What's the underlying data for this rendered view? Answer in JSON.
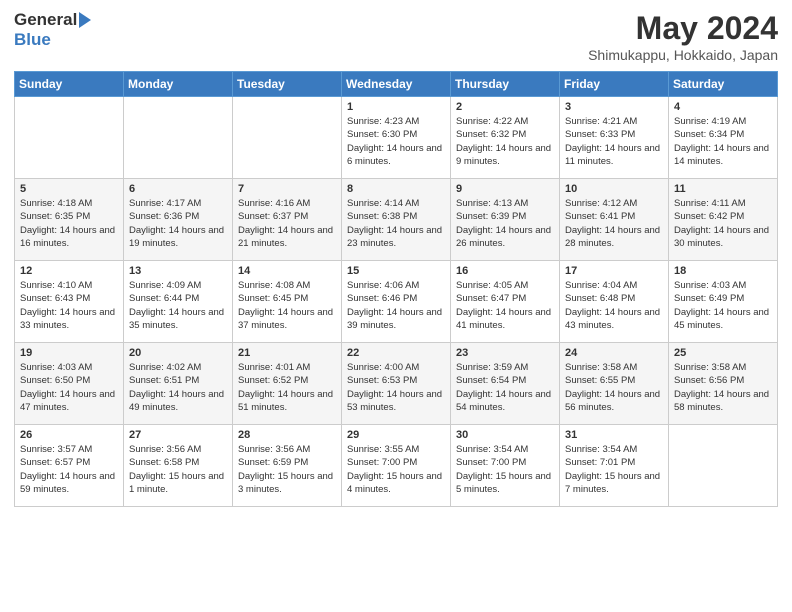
{
  "logo": {
    "general": "General",
    "blue": "Blue"
  },
  "title": {
    "month": "May 2024",
    "location": "Shimukappu, Hokkaido, Japan"
  },
  "calendar": {
    "headers": [
      "Sunday",
      "Monday",
      "Tuesday",
      "Wednesday",
      "Thursday",
      "Friday",
      "Saturday"
    ],
    "weeks": [
      [
        {
          "day": "",
          "sunrise": "",
          "sunset": "",
          "daylight": ""
        },
        {
          "day": "",
          "sunrise": "",
          "sunset": "",
          "daylight": ""
        },
        {
          "day": "",
          "sunrise": "",
          "sunset": "",
          "daylight": ""
        },
        {
          "day": "1",
          "sunrise": "Sunrise: 4:23 AM",
          "sunset": "Sunset: 6:30 PM",
          "daylight": "Daylight: 14 hours and 6 minutes."
        },
        {
          "day": "2",
          "sunrise": "Sunrise: 4:22 AM",
          "sunset": "Sunset: 6:32 PM",
          "daylight": "Daylight: 14 hours and 9 minutes."
        },
        {
          "day": "3",
          "sunrise": "Sunrise: 4:21 AM",
          "sunset": "Sunset: 6:33 PM",
          "daylight": "Daylight: 14 hours and 11 minutes."
        },
        {
          "day": "4",
          "sunrise": "Sunrise: 4:19 AM",
          "sunset": "Sunset: 6:34 PM",
          "daylight": "Daylight: 14 hours and 14 minutes."
        }
      ],
      [
        {
          "day": "5",
          "sunrise": "Sunrise: 4:18 AM",
          "sunset": "Sunset: 6:35 PM",
          "daylight": "Daylight: 14 hours and 16 minutes."
        },
        {
          "day": "6",
          "sunrise": "Sunrise: 4:17 AM",
          "sunset": "Sunset: 6:36 PM",
          "daylight": "Daylight: 14 hours and 19 minutes."
        },
        {
          "day": "7",
          "sunrise": "Sunrise: 4:16 AM",
          "sunset": "Sunset: 6:37 PM",
          "daylight": "Daylight: 14 hours and 21 minutes."
        },
        {
          "day": "8",
          "sunrise": "Sunrise: 4:14 AM",
          "sunset": "Sunset: 6:38 PM",
          "daylight": "Daylight: 14 hours and 23 minutes."
        },
        {
          "day": "9",
          "sunrise": "Sunrise: 4:13 AM",
          "sunset": "Sunset: 6:39 PM",
          "daylight": "Daylight: 14 hours and 26 minutes."
        },
        {
          "day": "10",
          "sunrise": "Sunrise: 4:12 AM",
          "sunset": "Sunset: 6:41 PM",
          "daylight": "Daylight: 14 hours and 28 minutes."
        },
        {
          "day": "11",
          "sunrise": "Sunrise: 4:11 AM",
          "sunset": "Sunset: 6:42 PM",
          "daylight": "Daylight: 14 hours and 30 minutes."
        }
      ],
      [
        {
          "day": "12",
          "sunrise": "Sunrise: 4:10 AM",
          "sunset": "Sunset: 6:43 PM",
          "daylight": "Daylight: 14 hours and 33 minutes."
        },
        {
          "day": "13",
          "sunrise": "Sunrise: 4:09 AM",
          "sunset": "Sunset: 6:44 PM",
          "daylight": "Daylight: 14 hours and 35 minutes."
        },
        {
          "day": "14",
          "sunrise": "Sunrise: 4:08 AM",
          "sunset": "Sunset: 6:45 PM",
          "daylight": "Daylight: 14 hours and 37 minutes."
        },
        {
          "day": "15",
          "sunrise": "Sunrise: 4:06 AM",
          "sunset": "Sunset: 6:46 PM",
          "daylight": "Daylight: 14 hours and 39 minutes."
        },
        {
          "day": "16",
          "sunrise": "Sunrise: 4:05 AM",
          "sunset": "Sunset: 6:47 PM",
          "daylight": "Daylight: 14 hours and 41 minutes."
        },
        {
          "day": "17",
          "sunrise": "Sunrise: 4:04 AM",
          "sunset": "Sunset: 6:48 PM",
          "daylight": "Daylight: 14 hours and 43 minutes."
        },
        {
          "day": "18",
          "sunrise": "Sunrise: 4:03 AM",
          "sunset": "Sunset: 6:49 PM",
          "daylight": "Daylight: 14 hours and 45 minutes."
        }
      ],
      [
        {
          "day": "19",
          "sunrise": "Sunrise: 4:03 AM",
          "sunset": "Sunset: 6:50 PM",
          "daylight": "Daylight: 14 hours and 47 minutes."
        },
        {
          "day": "20",
          "sunrise": "Sunrise: 4:02 AM",
          "sunset": "Sunset: 6:51 PM",
          "daylight": "Daylight: 14 hours and 49 minutes."
        },
        {
          "day": "21",
          "sunrise": "Sunrise: 4:01 AM",
          "sunset": "Sunset: 6:52 PM",
          "daylight": "Daylight: 14 hours and 51 minutes."
        },
        {
          "day": "22",
          "sunrise": "Sunrise: 4:00 AM",
          "sunset": "Sunset: 6:53 PM",
          "daylight": "Daylight: 14 hours and 53 minutes."
        },
        {
          "day": "23",
          "sunrise": "Sunrise: 3:59 AM",
          "sunset": "Sunset: 6:54 PM",
          "daylight": "Daylight: 14 hours and 54 minutes."
        },
        {
          "day": "24",
          "sunrise": "Sunrise: 3:58 AM",
          "sunset": "Sunset: 6:55 PM",
          "daylight": "Daylight: 14 hours and 56 minutes."
        },
        {
          "day": "25",
          "sunrise": "Sunrise: 3:58 AM",
          "sunset": "Sunset: 6:56 PM",
          "daylight": "Daylight: 14 hours and 58 minutes."
        }
      ],
      [
        {
          "day": "26",
          "sunrise": "Sunrise: 3:57 AM",
          "sunset": "Sunset: 6:57 PM",
          "daylight": "Daylight: 14 hours and 59 minutes."
        },
        {
          "day": "27",
          "sunrise": "Sunrise: 3:56 AM",
          "sunset": "Sunset: 6:58 PM",
          "daylight": "Daylight: 15 hours and 1 minute."
        },
        {
          "day": "28",
          "sunrise": "Sunrise: 3:56 AM",
          "sunset": "Sunset: 6:59 PM",
          "daylight": "Daylight: 15 hours and 3 minutes."
        },
        {
          "day": "29",
          "sunrise": "Sunrise: 3:55 AM",
          "sunset": "Sunset: 7:00 PM",
          "daylight": "Daylight: 15 hours and 4 minutes."
        },
        {
          "day": "30",
          "sunrise": "Sunrise: 3:54 AM",
          "sunset": "Sunset: 7:00 PM",
          "daylight": "Daylight: 15 hours and 5 minutes."
        },
        {
          "day": "31",
          "sunrise": "Sunrise: 3:54 AM",
          "sunset": "Sunset: 7:01 PM",
          "daylight": "Daylight: 15 hours and 7 minutes."
        },
        {
          "day": "",
          "sunrise": "",
          "sunset": "",
          "daylight": ""
        }
      ]
    ]
  }
}
